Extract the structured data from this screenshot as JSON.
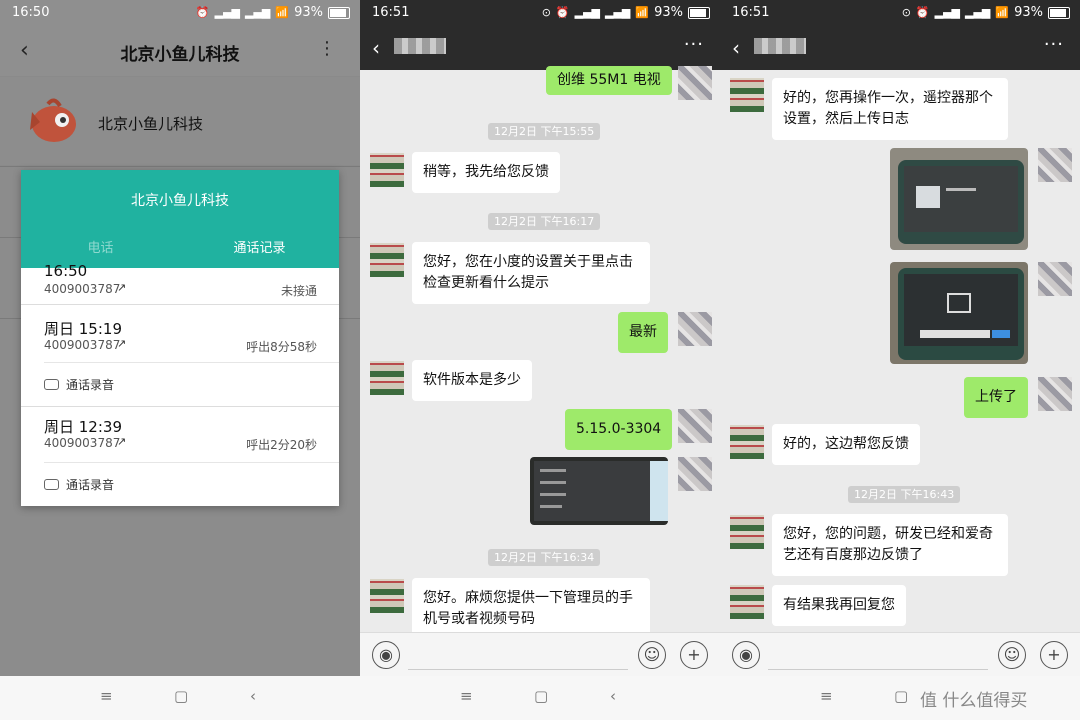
{
  "panel1": {
    "status": {
      "time": "16:50",
      "battery": "93%"
    },
    "header": {
      "title": "北京小鱼儿科技"
    },
    "profile": {
      "name": "北京小鱼儿科技"
    },
    "dialog": {
      "title": "北京小鱼儿科技",
      "tabs": [
        {
          "label": "电话"
        },
        {
          "label": "通话记录"
        }
      ],
      "calls": [
        {
          "time": "16:50",
          "number": "4009003787",
          "status": "未接通"
        },
        {
          "time": "周日 15:19",
          "number": "4009003787",
          "status": "呼出8分58秒",
          "recording": "通话录音"
        },
        {
          "time": "周日 12:39",
          "number": "4009003787",
          "status": "呼出2分20秒",
          "recording": "通话录音"
        }
      ]
    }
  },
  "panel2": {
    "status": {
      "time": "16:51",
      "battery": "93%"
    },
    "messages": [
      {
        "side": "right",
        "text": "创维 55M1 电视"
      },
      {
        "stamp": "12月2日 下午15:55"
      },
      {
        "side": "left",
        "text": "稍等，我先给您反馈"
      },
      {
        "stamp": "12月2日 下午16:17"
      },
      {
        "side": "left",
        "text": "您好，您在小度的设置关于里点击检查更新看什么提示"
      },
      {
        "side": "right",
        "text": "最新"
      },
      {
        "side": "left",
        "text": "软件版本是多少"
      },
      {
        "side": "right",
        "text": "5.15.0-3304"
      },
      {
        "side": "right",
        "image": "screenshot-settings"
      },
      {
        "stamp": "12月2日 下午16:34"
      },
      {
        "side": "left",
        "text": "您好。麻烦您提供一下管理员的手机号或者视频号码"
      }
    ]
  },
  "panel3": {
    "status": {
      "time": "16:51",
      "battery": "93%"
    },
    "messages": [
      {
        "side": "left",
        "text": "好的，您再操作一次，遥控器那个设置，然后上传日志"
      },
      {
        "side": "right",
        "image": "device-photo-1"
      },
      {
        "side": "right",
        "image": "device-photo-2"
      },
      {
        "side": "right",
        "text": "上传了"
      },
      {
        "side": "left",
        "text": "好的，这边帮您反馈"
      },
      {
        "stamp": "12月2日 下午16:43"
      },
      {
        "side": "left",
        "text": "您好，您的问题，研发已经和爱奇艺还有百度那边反馈了"
      },
      {
        "side": "left",
        "text": "有结果我再回复您"
      }
    ],
    "watermark": "值 什么值得买"
  },
  "icons": {
    "back": "back-arrow-icon",
    "more": "more-icon",
    "voice": "voice-icon",
    "emoji": "emoji-icon",
    "plus": "plus-icon"
  }
}
